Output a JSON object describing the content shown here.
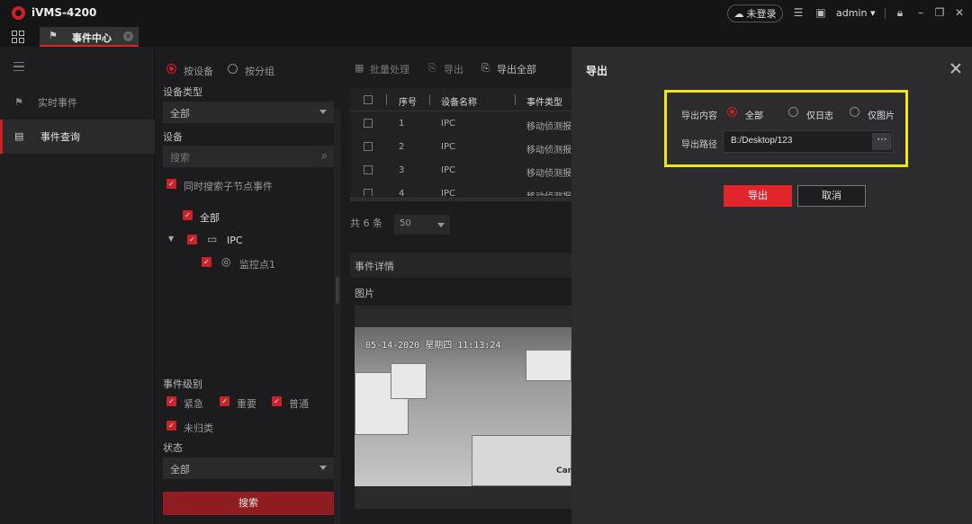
{
  "app": {
    "title": "iVMS-4200",
    "login_label": "未登录",
    "user": "admin"
  },
  "tabs": [
    {
      "label": "事件中心"
    }
  ],
  "nav": {
    "items": [
      {
        "label": "实时事件"
      },
      {
        "label": "事件查询"
      }
    ]
  },
  "filter": {
    "mode_options": [
      "按设备",
      "按分组"
    ],
    "device_type_label": "设备类型",
    "device_type_value": "全部",
    "device_label": "设备",
    "search_placeholder": "搜索",
    "include_sub_label": "同时搜索子节点事件",
    "tree": {
      "root": "全部",
      "device": "IPC",
      "channel": "监控点1"
    },
    "level_label": "事件级别",
    "levels": [
      "紧急",
      "重要",
      "普通",
      "未归类"
    ],
    "status_label": "状态",
    "status_value": "全部",
    "search_button": "搜索"
  },
  "toolbar": {
    "batch": "批量处理",
    "export": "导出",
    "export_all": "导出全部"
  },
  "table": {
    "headers": [
      "序号",
      "设备名称",
      "事件类型"
    ],
    "rows": [
      {
        "index": "1",
        "device": "IPC",
        "type": "移动侦测报警"
      },
      {
        "index": "2",
        "device": "IPC",
        "type": "移动侦测报警"
      },
      {
        "index": "3",
        "device": "IPC",
        "type": "移动侦测报警"
      },
      {
        "index": "4",
        "device": "IPC",
        "type": "移动侦测报警"
      }
    ],
    "total": "共 6 条",
    "page_size": "50"
  },
  "detail": {
    "title": "事件详情",
    "picture_label": "图片",
    "timestamp": "05-14-2020 星期四 11:13:24",
    "brand_text": "Car"
  },
  "modal": {
    "title": "导出",
    "content_label": "导出内容",
    "content_options": [
      "全部",
      "仅日志",
      "仅图片"
    ],
    "path_label": "导出路径",
    "path_value": "B:/Desktop/123",
    "browse_label": "···",
    "export_button": "导出",
    "cancel_button": "取消"
  },
  "colors": {
    "accent": "#e0262b",
    "highlight": "#f1e60f"
  }
}
